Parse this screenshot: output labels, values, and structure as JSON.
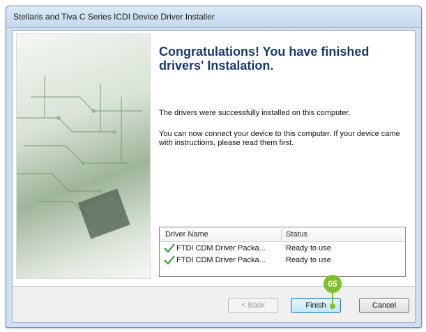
{
  "window": {
    "title": "Stellaris and Tiva C Series ICDI Device Driver Installer"
  },
  "content": {
    "heading": "Congratulations! You have finished drivers' Instalation.",
    "message1": "The drivers were successfully installed on this computer.",
    "message2": "You can now connect your device to this computer. If your device came with instructions, please read them first."
  },
  "driver_list": {
    "columns": [
      "Driver Name",
      "Status"
    ],
    "rows": [
      {
        "icon": "checkmark-icon",
        "name": "FTDI CDM Driver Packa...",
        "status": "Ready to use"
      },
      {
        "icon": "checkmark-icon",
        "name": "FTDI CDM Driver Packa...",
        "status": "Ready to use"
      }
    ]
  },
  "buttons": {
    "back": "< Back",
    "finish": "Finish",
    "cancel": "Cancel"
  },
  "callout": {
    "label": "05"
  },
  "colors": {
    "heading": "#1a3a6e",
    "check": "#2e9b2e",
    "callout": "#7fbf2a"
  }
}
